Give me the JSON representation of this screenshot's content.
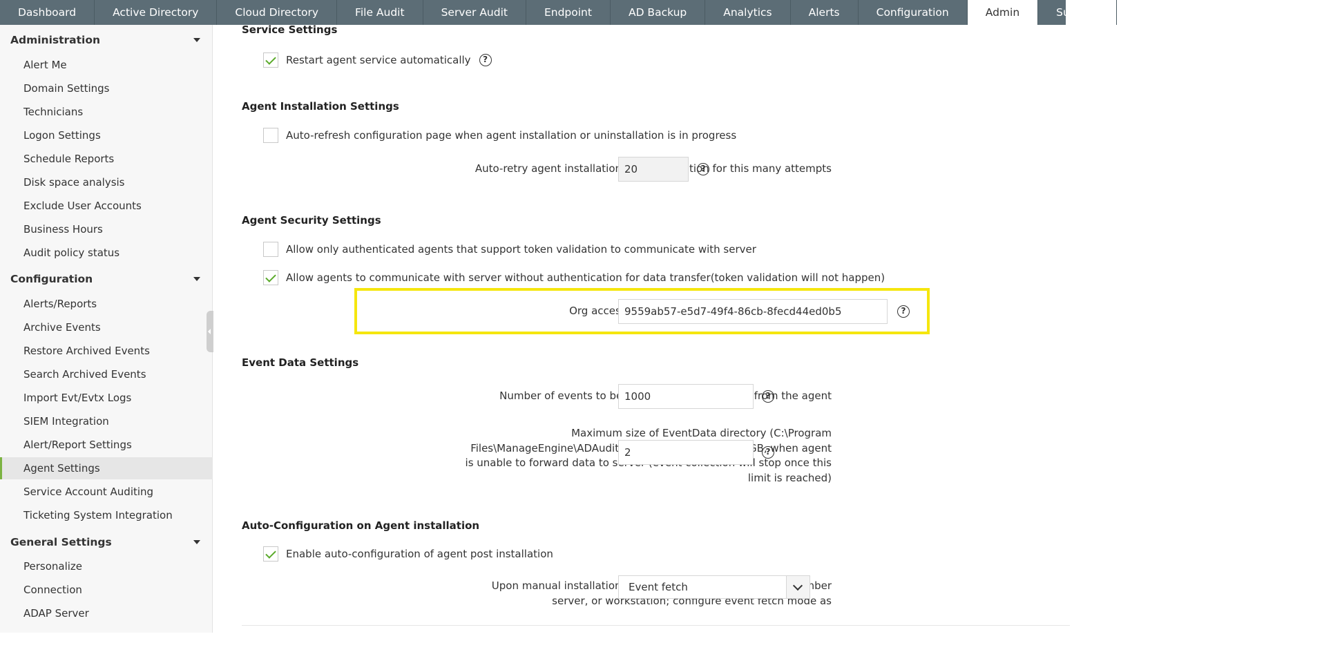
{
  "topnav": {
    "tabs": [
      "Dashboard",
      "Active Directory",
      "Cloud Directory",
      "File Audit",
      "Server Audit",
      "Endpoint",
      "AD Backup",
      "Analytics",
      "Alerts",
      "Configuration",
      "Admin",
      "Support"
    ],
    "active": "Admin"
  },
  "sidebar": {
    "administration": {
      "title": "Administration",
      "items": [
        "Alert Me",
        "Domain Settings",
        "Technicians",
        "Logon Settings",
        "Schedule Reports",
        "Disk space analysis",
        "Exclude User Accounts",
        "Business Hours",
        "Audit policy status"
      ]
    },
    "configuration": {
      "title": "Configuration",
      "items": [
        "Alerts/Reports",
        "Archive Events",
        "Restore Archived Events",
        "Search Archived Events",
        "Import Evt/Evtx Logs",
        "SIEM Integration",
        "Alert/Report Settings",
        "Agent Settings",
        "Service Account Auditing",
        "Ticketing System Integration"
      ],
      "active": "Agent Settings"
    },
    "general": {
      "title": "General Settings",
      "items": [
        "Personalize",
        "Connection",
        "ADAP Server"
      ]
    }
  },
  "main": {
    "service": {
      "title": "Service Settings",
      "restart_label": "Restart agent service automatically"
    },
    "installation": {
      "title": "Agent Installation Settings",
      "autorefresh_label": "Auto-refresh configuration page when agent installation or uninstallation is in progress",
      "retry_label": "Auto-retry agent installation or uninstallation for this many attempts",
      "retry_value": "20"
    },
    "security": {
      "title": "Agent Security Settings",
      "token_label": "Allow only authenticated agents that support token validation to communicate with server",
      "noauth_label": "Allow agents to communicate with server without authentication for data transfer(token validation will not happen)",
      "orgkey_label": "Org access key for agent to server communication",
      "orgkey_value": "9559ab57-e5d7-49f4-86cb-8fecd44ed0b5"
    },
    "eventdata": {
      "title": "Event Data Settings",
      "events_label": "Number of events to be sent on a single request from the agent",
      "events_value": "1000",
      "maxsize_line1": "Maximum size of EventData directory (C:\\Program",
      "maxsize_line2": "Files\\ManageEngine\\ADAuditPlusAgent\\EventData) in GB, when agent",
      "maxsize_line3": "is unable to forward data to server (event collection will stop once this",
      "maxsize_line4": "limit is reached)",
      "maxsize_value": "2"
    },
    "autoconfig": {
      "title": "Auto-Configuration on Agent installation",
      "enable_label": "Enable auto-configuration of agent post installation",
      "mode_line1": "Upon manual installation of the agent on DC, file server, member",
      "mode_line2": "server, or workstation; configure event fetch mode as",
      "mode_value": "Event fetch"
    },
    "help_glyph": "?"
  },
  "colors": {
    "nav_bg": "#5c6d76",
    "highlight": "#f5e60e",
    "check": "#5aaa2a",
    "active_marker": "#7cb342"
  }
}
